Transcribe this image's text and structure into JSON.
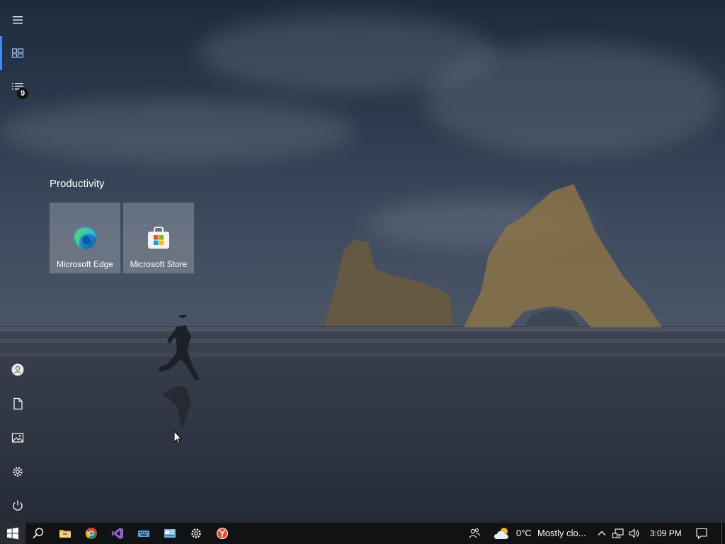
{
  "start_menu": {
    "group_title": "Productivity",
    "tiles": [
      {
        "label": "Microsoft Edge",
        "icon": "edge-icon"
      },
      {
        "label": "Microsoft Store",
        "icon": "store-icon"
      }
    ],
    "rail": {
      "expand": "hamburger-menu-icon",
      "tiles": "tiles-icon",
      "all_apps": "all-apps-list-icon",
      "all_apps_badge": "9",
      "account": "account-icon",
      "documents": "documents-icon",
      "pictures": "pictures-icon",
      "settings": "settings-icon",
      "power": "power-icon"
    }
  },
  "taskbar": {
    "apps": [
      "start-icon",
      "search-icon",
      "file-explorer-icon",
      "chrome-icon",
      "visual-studio-icon",
      "touch-keyboard-icon",
      "control-panel-icon",
      "settings-icon",
      "yandex-browser-icon"
    ],
    "weather": {
      "temp": "0°C",
      "condition": "Mostly clo..."
    },
    "clock": "3:09 PM"
  },
  "colors": {
    "accent": "#3b8eea",
    "taskbar": "#101214",
    "tile": "rgba(255,255,255,0.22)"
  }
}
